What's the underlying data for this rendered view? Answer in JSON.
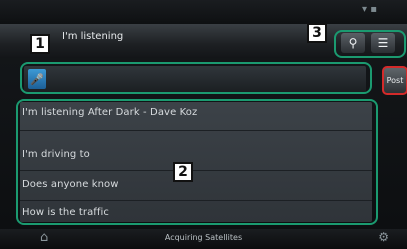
{
  "header": {
    "title": "I'm listening"
  },
  "toolbar": {
    "search_icon_glyph": "⚲",
    "menu_icon_glyph": "☰"
  },
  "input": {
    "mic_icon_glyph": "🎤",
    "post_label": "Post"
  },
  "list": {
    "items": [
      "I'm listening After Dark - Dave Koz",
      "I'm driving to",
      "Does anyone know",
      "How is the traffic"
    ]
  },
  "status": {
    "text": "Acquiring Satellites"
  },
  "callouts": [
    "1",
    "2",
    "3"
  ],
  "colors": {
    "callout_green": "#1b9a70",
    "highlight_red": "#d42a2a",
    "mic_blue": "#2f82c0"
  }
}
